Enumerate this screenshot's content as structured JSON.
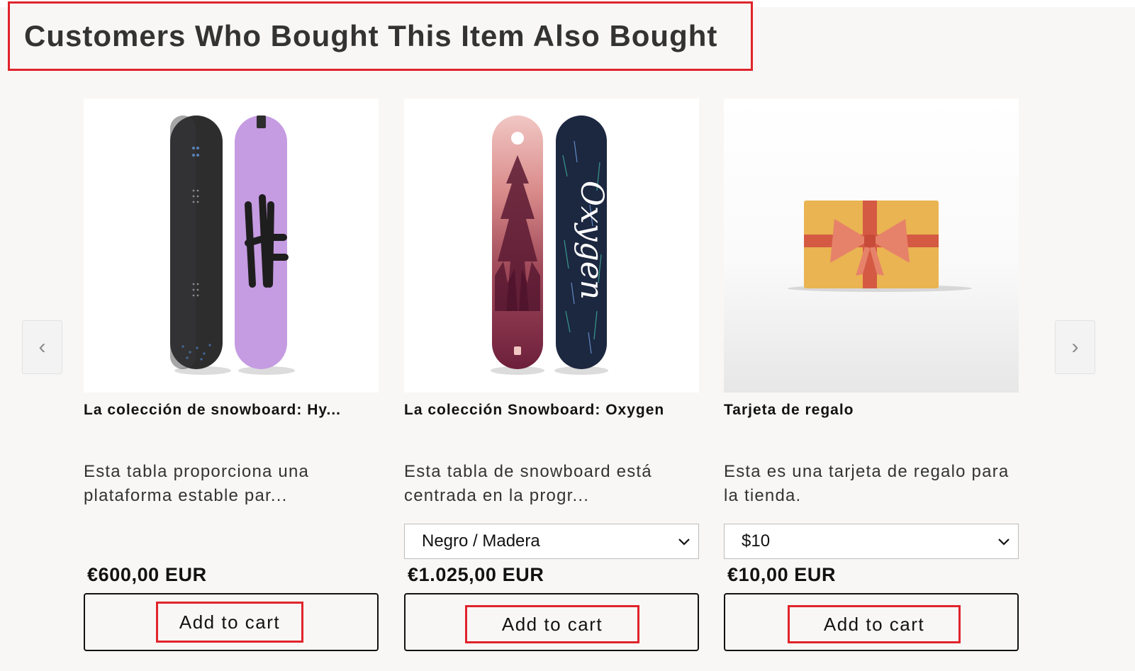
{
  "section": {
    "heading": "Customers Who Bought This Item Also Bought",
    "prev_label": "‹",
    "next_label": "›",
    "colors": {
      "highlight": "#e0242b",
      "background": "#f8f7f5"
    }
  },
  "products": [
    {
      "title": "La colección de snowboard: Hy...",
      "description": "Esta tabla proporciona una plataforma estable par...",
      "variant": null,
      "price": "€600,00 EUR",
      "button_label": "Add to cart",
      "image_icon": "snowboard-pair-black-lilac"
    },
    {
      "title": "La colección Snowboard: Oxygen",
      "description": "Esta tabla de snowboard está centrada en la progr...",
      "variant": "Negro / Madera",
      "price": "€1.025,00 EUR",
      "button_label": "Add to cart",
      "image_icon": "snowboard-pair-pink-navy"
    },
    {
      "title": "Tarjeta de regalo",
      "description": "Esta es una tarjeta de regalo para la tienda.",
      "variant": "$10",
      "price": "€10,00 EUR",
      "button_label": "Add to cart",
      "image_icon": "gift-card"
    }
  ]
}
